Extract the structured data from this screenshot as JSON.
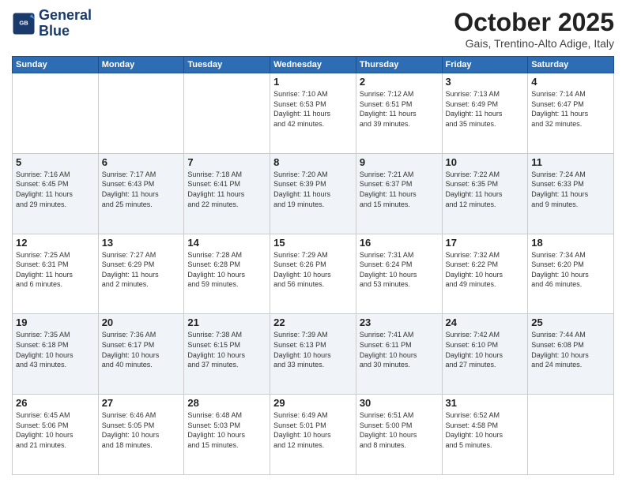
{
  "header": {
    "logo_line1": "General",
    "logo_line2": "Blue",
    "month": "October 2025",
    "location": "Gais, Trentino-Alto Adige, Italy"
  },
  "weekdays": [
    "Sunday",
    "Monday",
    "Tuesday",
    "Wednesday",
    "Thursday",
    "Friday",
    "Saturday"
  ],
  "weeks": [
    [
      {
        "day": "",
        "info": ""
      },
      {
        "day": "",
        "info": ""
      },
      {
        "day": "",
        "info": ""
      },
      {
        "day": "1",
        "info": "Sunrise: 7:10 AM\nSunset: 6:53 PM\nDaylight: 11 hours\nand 42 minutes."
      },
      {
        "day": "2",
        "info": "Sunrise: 7:12 AM\nSunset: 6:51 PM\nDaylight: 11 hours\nand 39 minutes."
      },
      {
        "day": "3",
        "info": "Sunrise: 7:13 AM\nSunset: 6:49 PM\nDaylight: 11 hours\nand 35 minutes."
      },
      {
        "day": "4",
        "info": "Sunrise: 7:14 AM\nSunset: 6:47 PM\nDaylight: 11 hours\nand 32 minutes."
      }
    ],
    [
      {
        "day": "5",
        "info": "Sunrise: 7:16 AM\nSunset: 6:45 PM\nDaylight: 11 hours\nand 29 minutes."
      },
      {
        "day": "6",
        "info": "Sunrise: 7:17 AM\nSunset: 6:43 PM\nDaylight: 11 hours\nand 25 minutes."
      },
      {
        "day": "7",
        "info": "Sunrise: 7:18 AM\nSunset: 6:41 PM\nDaylight: 11 hours\nand 22 minutes."
      },
      {
        "day": "8",
        "info": "Sunrise: 7:20 AM\nSunset: 6:39 PM\nDaylight: 11 hours\nand 19 minutes."
      },
      {
        "day": "9",
        "info": "Sunrise: 7:21 AM\nSunset: 6:37 PM\nDaylight: 11 hours\nand 15 minutes."
      },
      {
        "day": "10",
        "info": "Sunrise: 7:22 AM\nSunset: 6:35 PM\nDaylight: 11 hours\nand 12 minutes."
      },
      {
        "day": "11",
        "info": "Sunrise: 7:24 AM\nSunset: 6:33 PM\nDaylight: 11 hours\nand 9 minutes."
      }
    ],
    [
      {
        "day": "12",
        "info": "Sunrise: 7:25 AM\nSunset: 6:31 PM\nDaylight: 11 hours\nand 6 minutes."
      },
      {
        "day": "13",
        "info": "Sunrise: 7:27 AM\nSunset: 6:29 PM\nDaylight: 11 hours\nand 2 minutes."
      },
      {
        "day": "14",
        "info": "Sunrise: 7:28 AM\nSunset: 6:28 PM\nDaylight: 10 hours\nand 59 minutes."
      },
      {
        "day": "15",
        "info": "Sunrise: 7:29 AM\nSunset: 6:26 PM\nDaylight: 10 hours\nand 56 minutes."
      },
      {
        "day": "16",
        "info": "Sunrise: 7:31 AM\nSunset: 6:24 PM\nDaylight: 10 hours\nand 53 minutes."
      },
      {
        "day": "17",
        "info": "Sunrise: 7:32 AM\nSunset: 6:22 PM\nDaylight: 10 hours\nand 49 minutes."
      },
      {
        "day": "18",
        "info": "Sunrise: 7:34 AM\nSunset: 6:20 PM\nDaylight: 10 hours\nand 46 minutes."
      }
    ],
    [
      {
        "day": "19",
        "info": "Sunrise: 7:35 AM\nSunset: 6:18 PM\nDaylight: 10 hours\nand 43 minutes."
      },
      {
        "day": "20",
        "info": "Sunrise: 7:36 AM\nSunset: 6:17 PM\nDaylight: 10 hours\nand 40 minutes."
      },
      {
        "day": "21",
        "info": "Sunrise: 7:38 AM\nSunset: 6:15 PM\nDaylight: 10 hours\nand 37 minutes."
      },
      {
        "day": "22",
        "info": "Sunrise: 7:39 AM\nSunset: 6:13 PM\nDaylight: 10 hours\nand 33 minutes."
      },
      {
        "day": "23",
        "info": "Sunrise: 7:41 AM\nSunset: 6:11 PM\nDaylight: 10 hours\nand 30 minutes."
      },
      {
        "day": "24",
        "info": "Sunrise: 7:42 AM\nSunset: 6:10 PM\nDaylight: 10 hours\nand 27 minutes."
      },
      {
        "day": "25",
        "info": "Sunrise: 7:44 AM\nSunset: 6:08 PM\nDaylight: 10 hours\nand 24 minutes."
      }
    ],
    [
      {
        "day": "26",
        "info": "Sunrise: 6:45 AM\nSunset: 5:06 PM\nDaylight: 10 hours\nand 21 minutes."
      },
      {
        "day": "27",
        "info": "Sunrise: 6:46 AM\nSunset: 5:05 PM\nDaylight: 10 hours\nand 18 minutes."
      },
      {
        "day": "28",
        "info": "Sunrise: 6:48 AM\nSunset: 5:03 PM\nDaylight: 10 hours\nand 15 minutes."
      },
      {
        "day": "29",
        "info": "Sunrise: 6:49 AM\nSunset: 5:01 PM\nDaylight: 10 hours\nand 12 minutes."
      },
      {
        "day": "30",
        "info": "Sunrise: 6:51 AM\nSunset: 5:00 PM\nDaylight: 10 hours\nand 8 minutes."
      },
      {
        "day": "31",
        "info": "Sunrise: 6:52 AM\nSunset: 4:58 PM\nDaylight: 10 hours\nand 5 minutes."
      },
      {
        "day": "",
        "info": ""
      }
    ]
  ]
}
